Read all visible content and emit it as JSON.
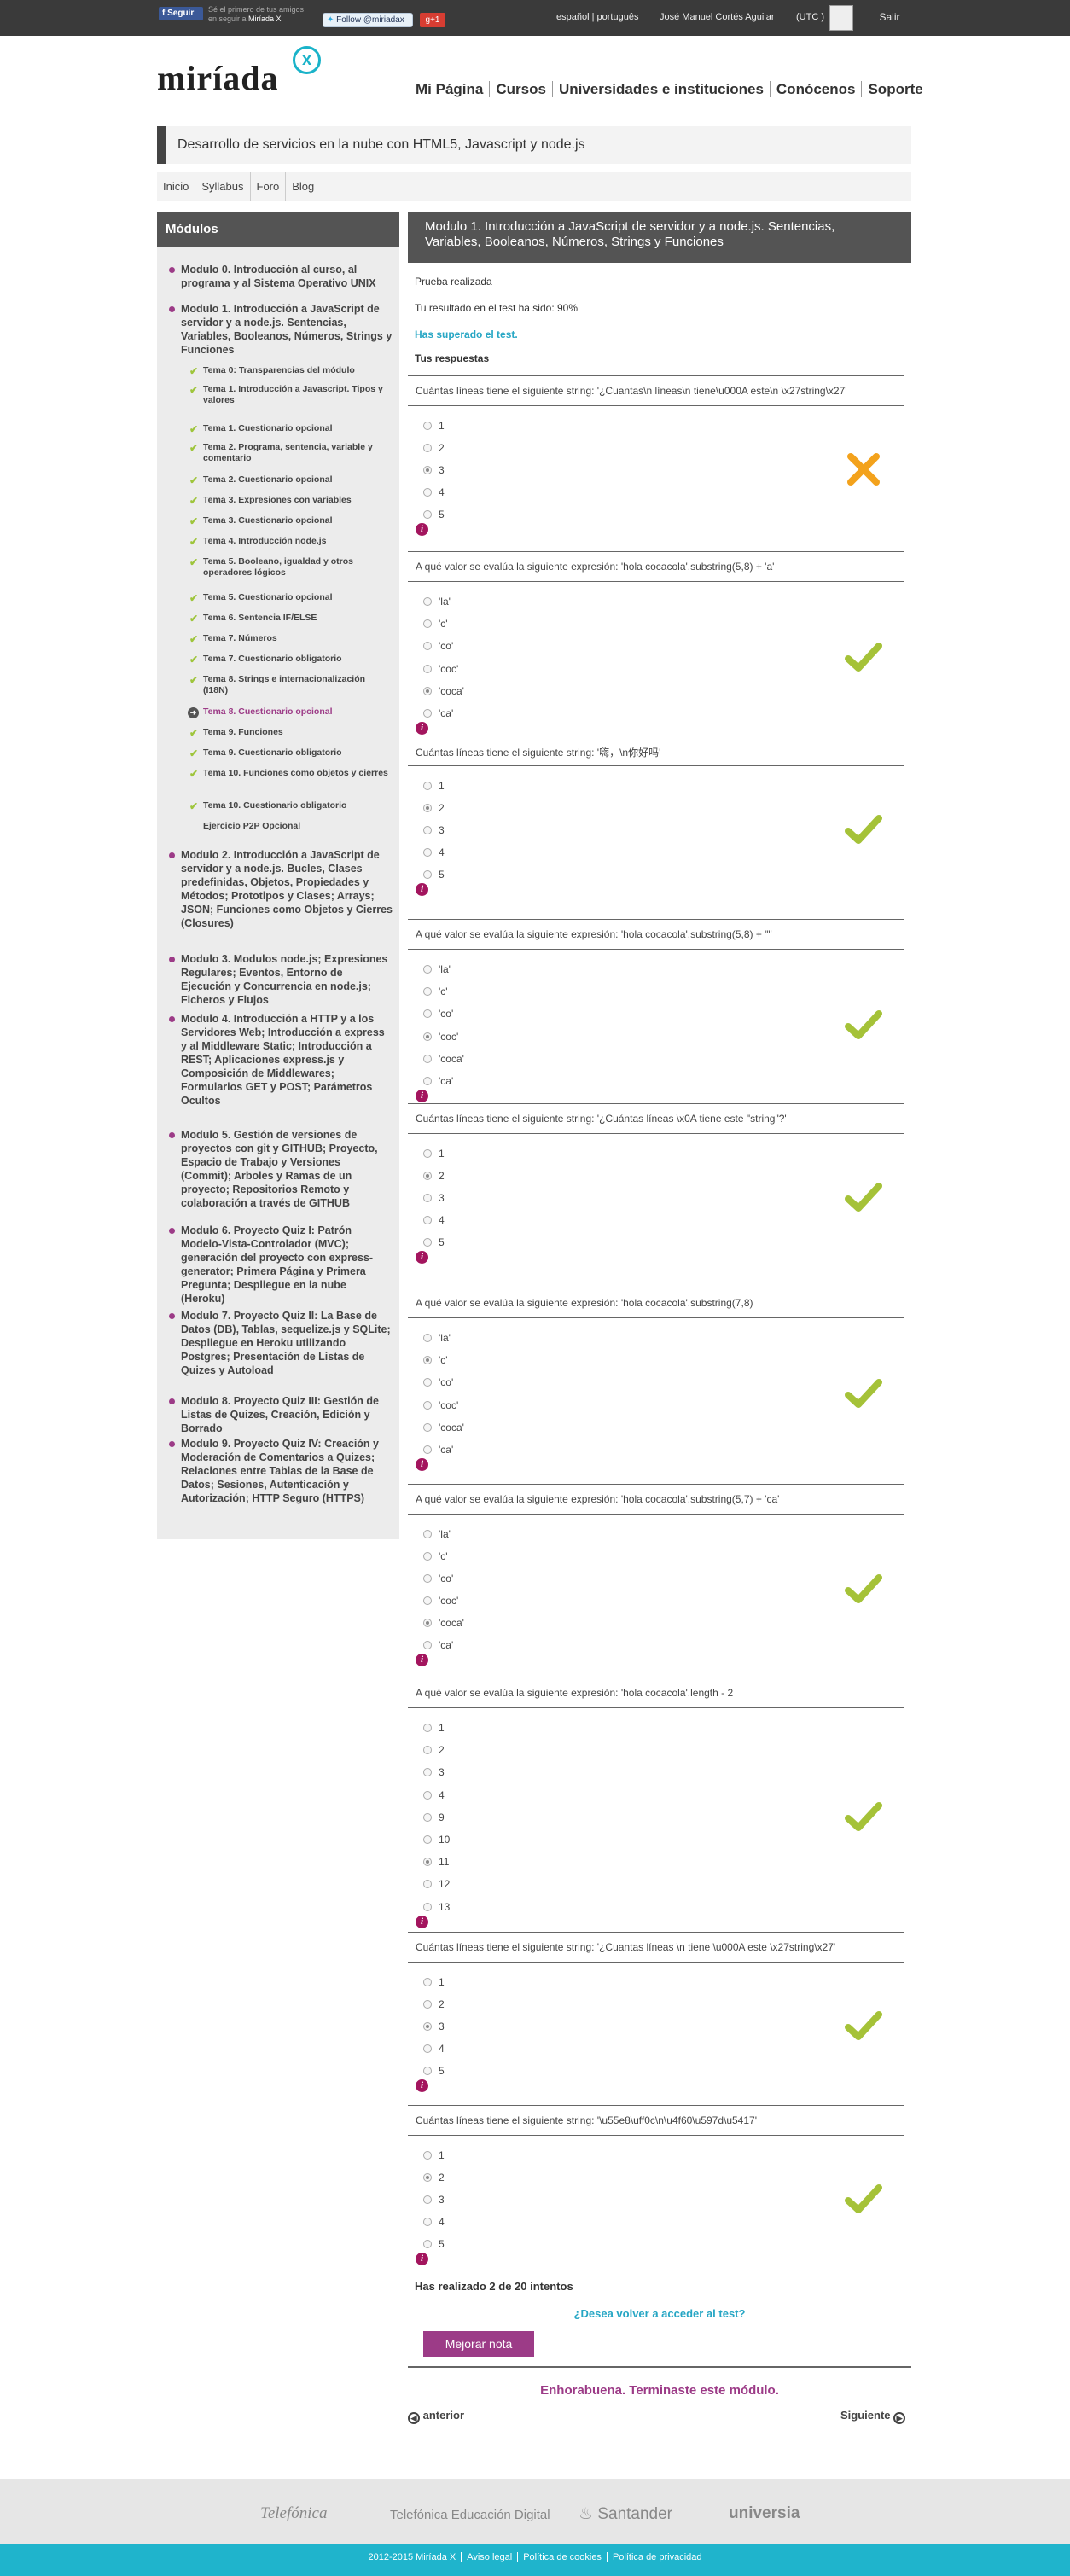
{
  "topbar": {
    "fb_button": "Seguir",
    "fb_text_1": "Sé el primero de tus amigos",
    "fb_text_2": "en seguir a",
    "fb_text_brand": "Miríada X",
    "twitter_button": "Follow @miriadax",
    "gplus_button": "g+1",
    "lang_es": "español",
    "lang_pt": "português",
    "user_name": "José Manuel Cortés Aguilar",
    "utc": "(UTC )",
    "logout": "Salir"
  },
  "header": {
    "logo": "miríada",
    "logo_x": "x",
    "nav": [
      "Mi Página",
      "Cursos",
      "Universidades e instituciones",
      "Conócenos",
      "Soporte"
    ]
  },
  "course": {
    "title": "Desarrollo de servicios en la nube con HTML5, Javascript y node.js",
    "subnav": [
      "Inicio",
      "Syllabus",
      "Foro",
      "Blog"
    ]
  },
  "sidebar": {
    "heading": "Módulos",
    "modules_top": [
      "Modulo 0. Introducción al curso, al programa y al Sistema Operativo UNIX",
      "Modulo 1. Introducción a JavaScript de servidor y a node.js. Sentencias, Variables, Booleanos, Números, Strings y Funciones"
    ],
    "temas": [
      "Tema 0: Transparencias del módulo",
      "Tema 1. Introducción a Javascript. Tipos y valores",
      "Tema 1. Cuestionario opcional",
      "Tema 2. Programa, sentencia, variable y comentario",
      "Tema 2. Cuestionario opcional",
      "Tema 3. Expresiones con variables",
      "Tema 3. Cuestionario opcional",
      "Tema 4. Introducción node.js",
      "Tema 5. Booleano, igualdad y otros operadores lógicos",
      "Tema 5. Cuestionario opcional",
      "Tema 6. Sentencia IF/ELSE",
      "Tema 7. Números",
      "Tema 7. Cuestionario obligatorio",
      "Tema 8. Strings e internacionalización (I18N)",
      "Tema 8. Cuestionario opcional",
      "Tema 9. Funciones",
      "Tema 9. Cuestionario obligatorio",
      "Tema 10. Funciones como objetos y cierres",
      "Tema 10. Cuestionario obligatorio",
      "Ejercicio P2P Opcional"
    ],
    "modules_bottom": [
      "Modulo 2. Introducción a JavaScript de servidor y a node.js. Bucles, Clases predefinidas, Objetos, Propiedades y Métodos; Prototipos y Clases; Arrays; JSON; Funciones como Objetos y Cierres (Closures)",
      "Modulo 3. Modulos node.js; Expresiones Regulares; Eventos, Entorno de Ejecución y Concurrencia en node.js; Ficheros y Flujos",
      "Modulo 4. Introducción a HTTP y a los Servidores Web; Introducción a express y al Middleware Static; Introducción a REST; Aplicaciones express.js y Composición de Middlewares; Formularios GET y POST; Parámetros Ocultos",
      "Modulo 5. Gestión de versiones de proyectos con git y GITHUB; Proyecto, Espacio de Trabajo y Versiones (Commit); Arboles y Ramas de un proyecto; Repositorios Remoto y colaboración a través de GITHUB",
      "Modulo 6. Proyecto Quiz I: Patrón Modelo-Vista-Controlador (MVC); generación del proyecto con express-generator; Primera Página y Primera Pregunta; Despliegue en la nube (Heroku)",
      "Modulo 7. Proyecto Quiz II: La Base de Datos (DB), Tablas, sequelize.js y SQLite; Despliegue en Heroku utilizando Postgres; Presentación de Listas de Quizes y Autoload",
      "Modulo 8. Proyecto Quiz III: Gestión de Listas de Quizes, Creación, Edición y Borrado",
      "Modulo 9. Proyecto Quiz IV: Creación y Moderación de Comentarios a Quizes; Relaciones entre Tablas de la Base de Datos; Sesiones, Autenticación y Autorización; HTTP Seguro (HTTPS)"
    ]
  },
  "content": {
    "heading": "Modulo 1. Introducción a JavaScript de servidor y a node.js. Sentencias, Variables, Booleanos, Números, Strings y Funciones",
    "status": "Prueba realizada",
    "result": "Tu resultado en el test ha sido: 90%",
    "passed": "Has superado el test.",
    "answers_heading": "Tus respuestas",
    "questions": [
      {
        "text": "Cuántas líneas tiene el siguiente string: '¿Cuantas\\n líneas\\n tiene\\u000A este\\n \\x27string\\x27'",
        "options": [
          "1",
          "2",
          "3",
          "4",
          "5"
        ],
        "selected": "3",
        "correct": false
      },
      {
        "text": "A qué valor se evalúa la siguiente expresión: 'hola cocacola'.substring(5,8) + 'a'",
        "options": [
          "'la'",
          "'c'",
          "'co'",
          "'coc'",
          "'coca'",
          "'ca'"
        ],
        "selected": "'coca'",
        "correct": true
      },
      {
        "text": "Cuántas líneas tiene el siguiente string: '嗨，\\n你好吗'",
        "options": [
          "1",
          "2",
          "3",
          "4",
          "5"
        ],
        "selected": "2",
        "correct": true
      },
      {
        "text": "A qué valor se evalúa la siguiente expresión: 'hola cocacola'.substring(5,8) + \"\"",
        "options": [
          "'la'",
          "'c'",
          "'co'",
          "'coc'",
          "'coca'",
          "'ca'"
        ],
        "selected": "'coc'",
        "correct": true
      },
      {
        "text": "Cuántas líneas tiene el siguiente string: '¿Cuántas líneas \\x0A tiene este \"string\"?'",
        "options": [
          "1",
          "2",
          "3",
          "4",
          "5"
        ],
        "selected": "2",
        "correct": true
      },
      {
        "text": "A qué valor se evalúa la siguiente expresión: 'hola cocacola'.substring(7,8)",
        "options": [
          "'la'",
          "'c'",
          "'co'",
          "'coc'",
          "'coca'",
          "'ca'"
        ],
        "selected": "'c'",
        "correct": true
      },
      {
        "text": "A qué valor se evalúa la siguiente expresión: 'hola cocacola'.substring(5,7) + 'ca'",
        "options": [
          "'la'",
          "'c'",
          "'co'",
          "'coc'",
          "'coca'",
          "'ca'"
        ],
        "selected": "'coca'",
        "correct": true
      },
      {
        "text": "A qué valor se evalúa la siguiente expresión: 'hola cocacola'.length - 2",
        "options": [
          "1",
          "2",
          "3",
          "4",
          "9",
          "10",
          "11",
          "12",
          "13"
        ],
        "selected": "11",
        "correct": true
      },
      {
        "text": "Cuántas líneas tiene el siguiente string: '¿Cuantas líneas \\n tiene \\u000A este \\x27string\\x27'",
        "options": [
          "1",
          "2",
          "3",
          "4",
          "5"
        ],
        "selected": "3",
        "correct": true
      },
      {
        "text": "Cuántas líneas tiene el siguiente string: '\\u55e8\\uff0c\\n\\u4f60\\u597d\\u5417'",
        "options": [
          "1",
          "2",
          "3",
          "4",
          "5"
        ],
        "selected": "2",
        "correct": true
      }
    ],
    "attempts": "Has realizado 2 de 20 intentos",
    "access_again": "¿Desea volver a acceder al test?",
    "improve_button": "Mejorar nota",
    "congrats": "Enhorabuena. Terminaste este módulo.",
    "prev": "anterior",
    "next": "Siguiente"
  },
  "footer": {
    "sponsors": [
      "Telefónica",
      "Telefónica Educación Digital",
      "Santander",
      "universia"
    ],
    "links": [
      "2012-2015 Miríada X",
      "Aviso legal",
      "Política de cookies",
      "Política de privacidad"
    ]
  },
  "colors": {
    "accent": "#9c3b87",
    "link": "#26a6c4",
    "check": "#a5c238",
    "cross": "#f3a21c",
    "info": "#a3155e"
  }
}
